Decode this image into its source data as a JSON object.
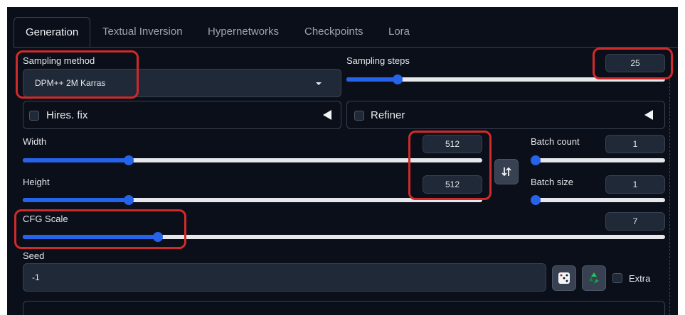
{
  "tabs": [
    {
      "label": "Generation",
      "active": true
    },
    {
      "label": "Textual Inversion",
      "active": false
    },
    {
      "label": "Hypernetworks",
      "active": false
    },
    {
      "label": "Checkpoints",
      "active": false
    },
    {
      "label": "Lora",
      "active": false
    }
  ],
  "sampling_method": {
    "label": "Sampling method",
    "value": "DPM++ 2M Karras"
  },
  "sampling_steps": {
    "label": "Sampling steps",
    "value": "25",
    "fraction": 0.16
  },
  "hires_fix": {
    "label": "Hires. fix",
    "checked": false
  },
  "refiner": {
    "label": "Refiner",
    "checked": false
  },
  "width": {
    "label": "Width",
    "value": "512",
    "fraction": 0.23
  },
  "height": {
    "label": "Height",
    "value": "512",
    "fraction": 0.23
  },
  "batch_count": {
    "label": "Batch count",
    "value": "1",
    "fraction": 0.0
  },
  "batch_size": {
    "label": "Batch size",
    "value": "1",
    "fraction": 0.0
  },
  "cfg_scale": {
    "label": "CFG Scale",
    "value": "7",
    "fraction": 0.21
  },
  "seed": {
    "label": "Seed",
    "value": "-1",
    "extra_label": "Extra"
  },
  "icons": {
    "swap": "swap-dimensions-icon",
    "dice": "dice-icon",
    "recycle": "recycle-icon",
    "dropdown": "chevron-down-icon",
    "collapse": "triangle-left-icon"
  },
  "colors": {
    "accent": "#2563eb",
    "highlight": "#d12a2a",
    "background": "#0b0f19"
  }
}
